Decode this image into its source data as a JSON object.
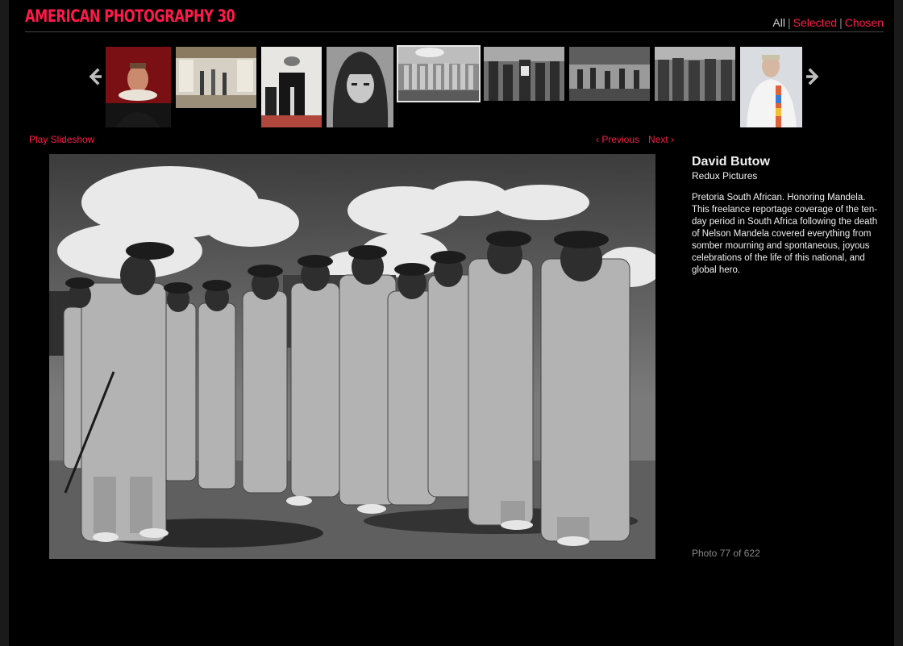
{
  "header": {
    "title": "AMERICAN PHOTOGRAPHY 30",
    "filters": {
      "all": "All",
      "separator": "|",
      "selected": "Selected",
      "chosen": "Chosen"
    }
  },
  "filmstrip": {
    "prev_icon": "chevron-left-icon",
    "next_icon": "chevron-right-icon",
    "thumbnails_count": 9,
    "active_thumbnail_index": 4
  },
  "controls": {
    "play_slideshow": "Play Slideshow",
    "previous": "‹ Previous",
    "next": "Next ›"
  },
  "photo": {
    "photographer": "David Butow",
    "agency": "Redux Pictures",
    "description": "Pretoria South African. Honoring Mandela. This freelance reportage coverage of the ten-day period in South Africa following the death of Nelson Mandela covered everything from somber mourning and spontaneous, joyous celebrations of the life of this national, and global hero.",
    "counter": "Photo 77 of 622"
  },
  "colors": {
    "accent": "#ff1a4b",
    "background": "#000000",
    "muted": "#8a8a8a"
  }
}
